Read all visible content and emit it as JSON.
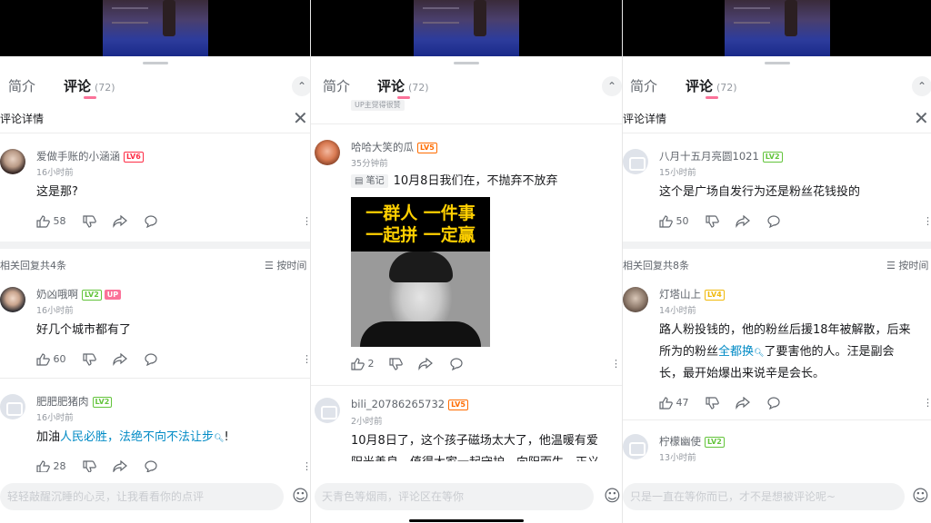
{
  "tabs": {
    "intro": "简介",
    "comments": "评论",
    "count": "(72)"
  },
  "panel1": {
    "detail_title": "评论详情",
    "main": {
      "user": "爱做手账的小涵涵",
      "level": "LV6",
      "time": "16小时前",
      "text": "这是那?",
      "likes": "58"
    },
    "reply_header": "相关回复共4条",
    "sort_label": "按时间",
    "replies": [
      {
        "user": "奶凶哦啊",
        "level": "LV2",
        "up": "UP",
        "time": "16小时前",
        "text": "好几个城市都有了",
        "likes": "60"
      },
      {
        "user": "肥肥肥猪肉",
        "level": "LV2",
        "time": "16小时前",
        "text_prefix": "加油",
        "link": "人民必胜，法绝不向不法让步",
        "text_suffix": "!",
        "likes": "28"
      }
    ],
    "input_placeholder": "轻轻敲醒沉睡的心灵，让我看看你的点评"
  },
  "panel2": {
    "stick_tag": "UP主觉得很赞",
    "main": {
      "user": "哈哈大笑的瓜",
      "level": "LV5",
      "time": "35分钟前",
      "note": "笔记",
      "text": "10月8日我们在，不抛弃不放弃",
      "likes": "2"
    },
    "poster": {
      "line1": "一群人 一件事",
      "line2": "一起拼 一定赢"
    },
    "second": {
      "user": "bili_20786265732",
      "level": "LV5",
      "time": "2小时前",
      "line1": "10月8日了，这个孩子磁场太大了，他温暖有爱",
      "line2": "阳光善良，值得大家一起守护，向阳而生，正义"
    },
    "input_placeholder": "天青色等烟雨，评论区在等你"
  },
  "panel3": {
    "detail_title": "评论详情",
    "main": {
      "user": "八月十五月亮圆1021",
      "level": "LV2",
      "time": "15小时前",
      "text": "这个是广场自发行为还是粉丝花钱投的",
      "likes": "50"
    },
    "reply_header": "相关回复共8条",
    "sort_label": "按时间",
    "replies": [
      {
        "user": "灯塔山上",
        "level": "LV4",
        "time": "14小时前",
        "line1": "路人粉投钱的，他的粉丝后援18年被解散，后来",
        "line2_prefix": "所为的粉丝",
        "link": "全都换",
        "line2_suffix": "了要害他的人。汪是副会",
        "line3": "长，最开始爆出来说辛是会长。",
        "likes": "47"
      },
      {
        "user": "柠檬幽使",
        "level": "LV2",
        "time": "13小时前"
      }
    ],
    "input_placeholder": "只是一直在等你而已，才不是想被评论呢~"
  },
  "icons": {
    "like": "thumb-up-icon",
    "dislike": "thumb-down-icon",
    "share": "share-icon",
    "reply": "reply-bubble-icon",
    "more": "more-vertical-icon",
    "emoji": "emoji-icon",
    "close": "close-icon",
    "sort": "sort-toggle-icon",
    "search": "search-icon"
  },
  "colors": {
    "accent": "#fb7299",
    "link": "#008ac5",
    "lv6": "#fe2d46",
    "lv5": "#ff6c00",
    "lv2": "#63c43b",
    "lv4": "#f0b90b"
  }
}
